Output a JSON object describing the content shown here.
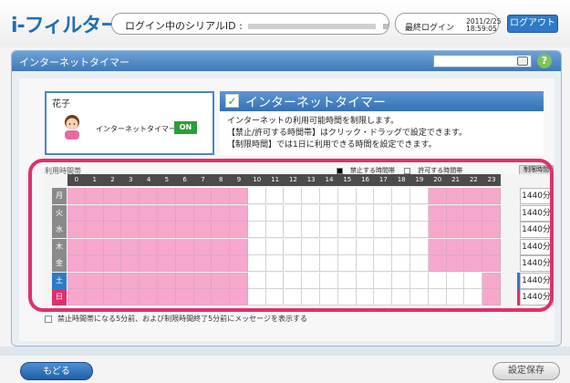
{
  "header": {
    "logo": "i-フィルター.",
    "serial_label": "ログイン中のシリアルID :",
    "login_label": "最終ログイン",
    "login_date": "2011/2/25",
    "login_time": "18:59:05",
    "logout_label": "ログアウト"
  },
  "panel": {
    "title": "インターネットタイマー",
    "search_placeholder": "",
    "help_label": "?"
  },
  "user": {
    "name": "花子",
    "timer_label": "インターネットタイマー",
    "status": "ON"
  },
  "info": {
    "title": "インターネットタイマー",
    "lines": [
      "インターネットの利用可能時間を制限します。",
      "【禁止/許可する時間帯】はクリック・ドラッグで設定できます。",
      "【制限時間】では1日に利用できる時間を設定できます。"
    ]
  },
  "schedule": {
    "label": "利用時間帯",
    "legend_forbid": "禁止する時間帯",
    "legend_allow": "許可する時間帯",
    "limit_header": "制限時間",
    "hours": [
      "0",
      "1",
      "2",
      "3",
      "4",
      "5",
      "6",
      "7",
      "8",
      "9",
      "10",
      "11",
      "12",
      "13",
      "14",
      "15",
      "16",
      "17",
      "18",
      "19",
      "20",
      "21",
      "22",
      "23"
    ],
    "rows": [
      {
        "day": "月",
        "limit": "1440分",
        "allowed_from": 10,
        "allowed_to": 20,
        "accent": ""
      },
      {
        "day": "火",
        "limit": "1440分",
        "allowed_from": 10,
        "allowed_to": 20,
        "accent": ""
      },
      {
        "day": "水",
        "limit": "1440分",
        "allowed_from": 10,
        "allowed_to": 20,
        "accent": ""
      },
      {
        "day": "木",
        "limit": "1440分",
        "allowed_from": 10,
        "allowed_to": 20,
        "accent": ""
      },
      {
        "day": "金",
        "limit": "1440分",
        "allowed_from": 10,
        "allowed_to": 20,
        "accent": ""
      },
      {
        "day": "土",
        "limit": "1440分",
        "allowed_from": 10,
        "allowed_to": 23,
        "accent": "#2f7ac7"
      },
      {
        "day": "日",
        "limit": "1440分",
        "allowed_from": 10,
        "allowed_to": 23,
        "accent": "#e0306e"
      }
    ],
    "notice": "禁止時間帯になる5分前、および制限時間終了5分前にメッセージを表示する"
  },
  "footer": {
    "back_label": "もどる",
    "save_label": "設定保存"
  },
  "colors": {
    "forbid": "#f6a8cc",
    "allow": "#ffffff",
    "accent_blue": "#2f7ac7",
    "highlight_frame": "#e0306e"
  }
}
